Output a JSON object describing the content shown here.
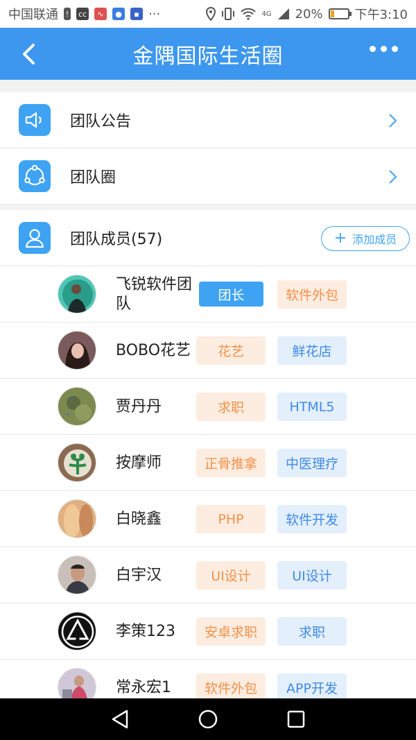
{
  "status_bar": {
    "carrier": "中国联通",
    "network": "4G",
    "battery": "20%",
    "time": "下午3:10",
    "icons": [
      "warning-icon",
      "cc-icon",
      "wave-icon",
      "paw-icon",
      "tx-icon",
      "more-dots-icon",
      "location-icon",
      "vibrate-icon",
      "wifi-icon",
      "signal-icon",
      "battery-icon"
    ]
  },
  "header": {
    "title": "金隅国际生活圈",
    "bg": "#3d97ee"
  },
  "sections": {
    "announcement": {
      "label": "团队公告"
    },
    "circle": {
      "label": "团队圈"
    },
    "members": {
      "label": "团队成员(57)",
      "add_label": "添加成员"
    }
  },
  "members": [
    {
      "name": "飞锐软件团队",
      "tag1": "团长",
      "tag2": "软件外包"
    },
    {
      "name": "BOBO花艺",
      "tag1": "花艺",
      "tag2": "鲜花店"
    },
    {
      "name": "贾丹丹",
      "tag1": "求职",
      "tag2": "HTML5"
    },
    {
      "name": "按摩师",
      "tag1": "正骨推拿",
      "tag2": "中医理疗"
    },
    {
      "name": "白晓鑫",
      "tag1": "PHP",
      "tag2": "软件开发"
    },
    {
      "name": "白宇汉",
      "tag1": "UI设计",
      "tag2": "UI设计"
    },
    {
      "name": "李策123",
      "tag1": "安卓求职",
      "tag2": "求职"
    },
    {
      "name": "常永宏1",
      "tag1": "软件外包",
      "tag2": "APP开发"
    }
  ],
  "colors": {
    "accent": "#3ea3f3",
    "tag_orange_bg": "#fdece0",
    "tag_orange_text": "#f2924a",
    "tag_blue_bg": "#e4effc",
    "tag_blue_text": "#3d8ae8"
  }
}
